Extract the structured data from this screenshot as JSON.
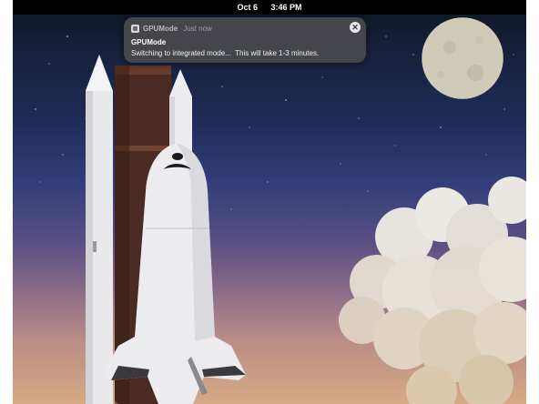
{
  "menubar": {
    "date": "Oct 6",
    "time": "3:46 PM"
  },
  "notification": {
    "app_name": "GPUMode",
    "timestamp": "Just now",
    "title": "GPUMode",
    "body": "Switching to integrated mode...  This will take 1-3 minutes.",
    "app_icon": "gpumode-app-icon",
    "close_icon": "close-icon",
    "close_glyph": "✕"
  },
  "wallpaper": {
    "description_icon": "space-shuttle-launch-wallpaper"
  },
  "colors": {
    "menubar_bg": "#000000",
    "notification_bg": "#48484c",
    "sky_top": "#0d1422",
    "sky_bottom": "#d6aa84"
  }
}
